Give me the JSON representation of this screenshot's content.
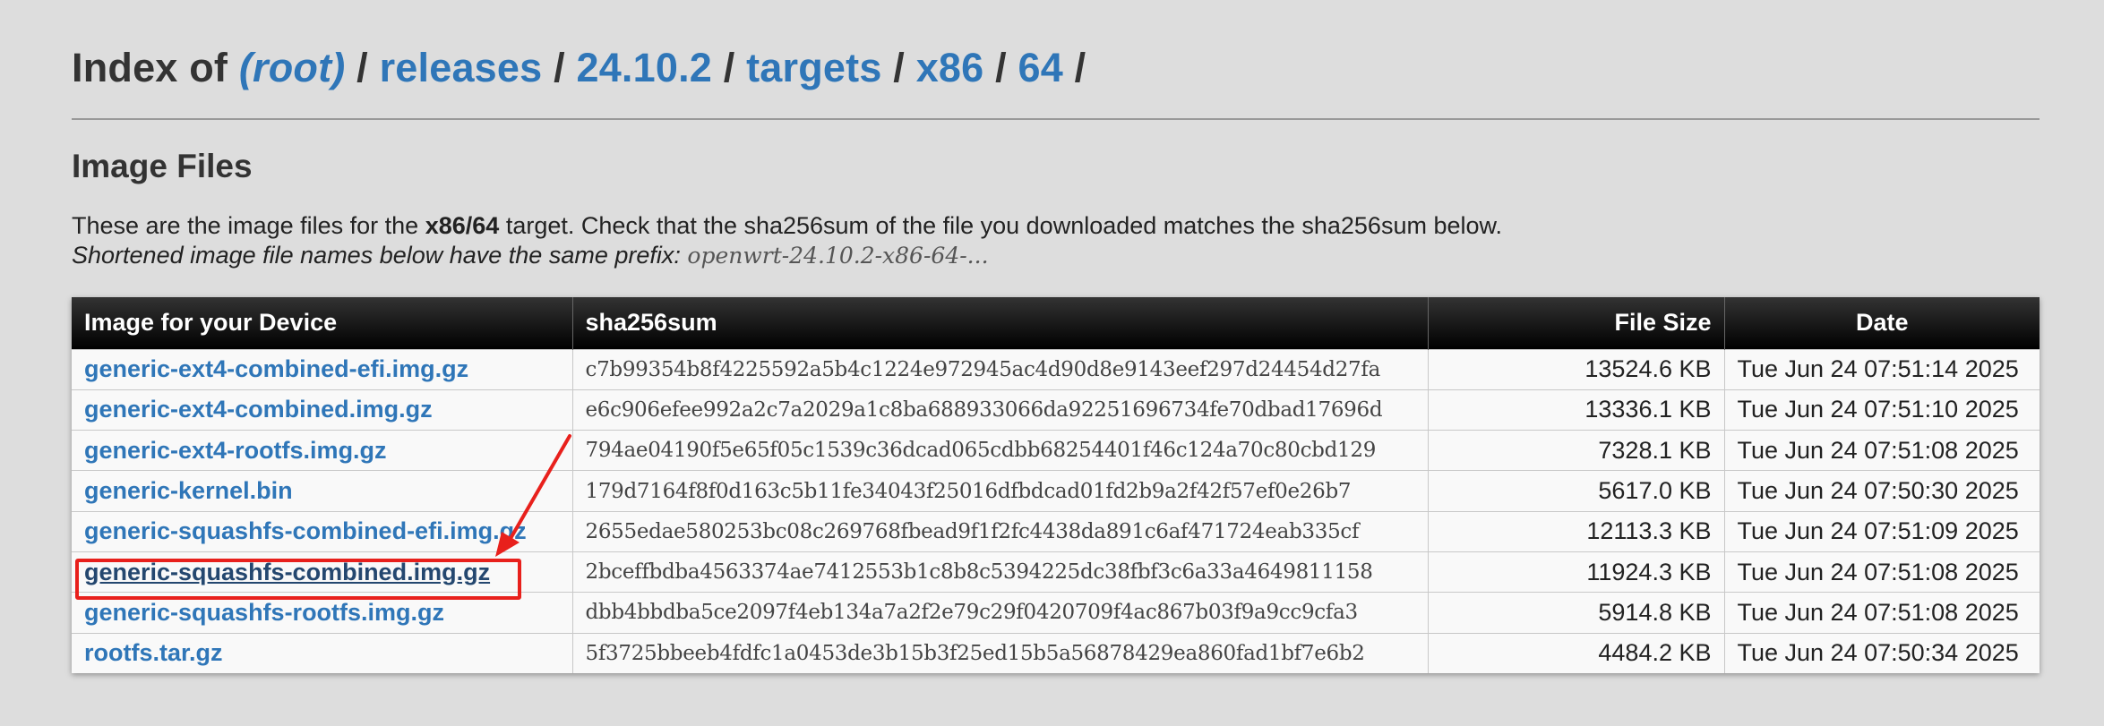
{
  "header": {
    "prefix": "Index of",
    "crumbs": [
      {
        "label": "(root)",
        "sep": "/"
      },
      {
        "label": "releases",
        "sep": "/"
      },
      {
        "label": "24.10.2",
        "sep": "/"
      },
      {
        "label": "targets",
        "sep": "/"
      },
      {
        "label": "x86",
        "sep": "/"
      },
      {
        "label": "64",
        "sep": "/"
      }
    ]
  },
  "section": {
    "title": "Image Files",
    "desc_a": "These are the image files for the ",
    "desc_target": "x86/64",
    "desc_b": " target. Check that the sha256sum of the file you downloaded matches the sha256sum below.",
    "prefix_note": "Shortened image file names below have the same prefix: ",
    "prefix_code": "openwrt-24.10.2-x86-64-..."
  },
  "table": {
    "headers": {
      "name": "Image for your Device",
      "sha": "sha256sum",
      "size": "File Size",
      "date": "Date"
    },
    "rows": [
      {
        "name": "generic-ext4-combined-efi.img.gz",
        "sha": "c7b99354b8f4225592a5b4c1224e972945ac4d90d8e9143eef297d24454d27fa",
        "size": "13524.6 KB",
        "date": "Tue Jun 24 07:51:14 2025"
      },
      {
        "name": "generic-ext4-combined.img.gz",
        "sha": "e6c906efee992a2c7a2029a1c8ba688933066da92251696734fe70dbad17696d",
        "size": "13336.1 KB",
        "date": "Tue Jun 24 07:51:10 2025"
      },
      {
        "name": "generic-ext4-rootfs.img.gz",
        "sha": "794ae04190f5e65f05c1539c36dcad065cdbb68254401f46c124a70c80cbd129",
        "size": "7328.1 KB",
        "date": "Tue Jun 24 07:51:08 2025"
      },
      {
        "name": "generic-kernel.bin",
        "sha": "179d7164f8f0d163c5b11fe34043f25016dfbdcad01fd2b9a2f42f57ef0e26b7",
        "size": "5617.0 KB",
        "date": "Tue Jun 24 07:50:30 2025"
      },
      {
        "name": "generic-squashfs-combined-efi.img.gz",
        "sha": "2655edae580253bc08c269768fbead9f1f2fc4438da891c6af471724eab335cf",
        "size": "12113.3 KB",
        "date": "Tue Jun 24 07:51:09 2025"
      },
      {
        "name": "generic-squashfs-combined.img.gz",
        "sha": "2bceffbdba4563374ae7412553b1c8b8c5394225dc38fbf3c6a33a4649811158",
        "size": "11924.3 KB",
        "date": "Tue Jun 24 07:51:08 2025"
      },
      {
        "name": "generic-squashfs-rootfs.img.gz",
        "sha": "dbb4bbdba5ce2097f4eb134a7a2f2e79c29f0420709f4ac867b03f9a9cc9cfa3",
        "size": "5914.8 KB",
        "date": "Tue Jun 24 07:51:08 2025"
      },
      {
        "name": "rootfs.tar.gz",
        "sha": "5f3725bbeeb4fdfc1a0453de3b15b3f25ed15b5a56878429ea860fad1bf7e6b2",
        "size": "4484.2 KB",
        "date": "Tue Jun 24 07:50:34 2025"
      }
    ]
  },
  "annotation": {
    "highlighted_row": 5,
    "color": "#e8201c"
  },
  "colors": {
    "link": "#2f76b8",
    "background": "#dddddd",
    "header_bg": "#000000"
  }
}
